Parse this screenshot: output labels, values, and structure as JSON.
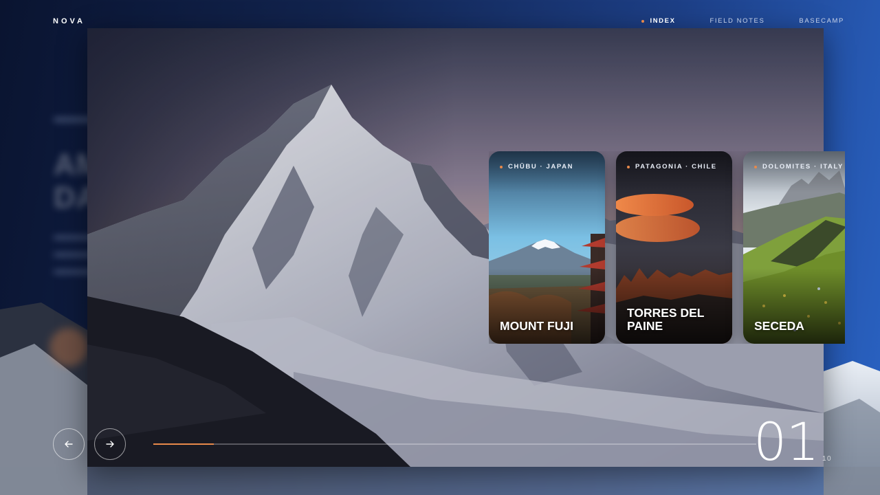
{
  "brand": {
    "logo": "NOVA"
  },
  "nav": {
    "items": [
      {
        "label": "INDEX",
        "active": true
      },
      {
        "label": "FIELD NOTES",
        "active": false
      },
      {
        "label": "BASECAMP",
        "active": false
      }
    ]
  },
  "hero": {
    "title_line1": "AMA",
    "title_line2": "DABLAM"
  },
  "cards": [
    {
      "tag": "CHŪBU · JAPAN",
      "title": "MOUNT FUJI"
    },
    {
      "tag": "PATAGONIA · CHILE",
      "title": "TORRES DEL PAINE"
    },
    {
      "tag": "DOLOMITES · ITALY",
      "title": "SECEDA"
    }
  ],
  "slider": {
    "current": "01",
    "total_suffix": "10",
    "progress": 0.1
  },
  "colors": {
    "accent": "#e8894a",
    "sky_top": "#0a1430",
    "sky_right": "#2a63c4"
  },
  "icons": {
    "prev": "arrow-left-icon",
    "next": "arrow-right-icon"
  }
}
